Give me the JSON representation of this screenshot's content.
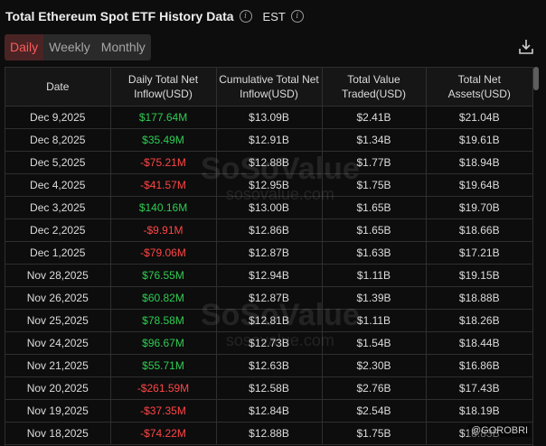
{
  "header": {
    "title": "Total Ethereum Spot ETF History Data",
    "timezone": "EST"
  },
  "tabs": [
    {
      "label": "Daily",
      "active": true
    },
    {
      "label": "Weekly",
      "active": false
    },
    {
      "label": "Monthly",
      "active": false
    }
  ],
  "icons": {
    "info": "info-circle-icon",
    "download": "download-icon"
  },
  "colors": {
    "positive": "#2ecc52",
    "negative": "#ff4545",
    "active_tab": "#ff5a5a"
  },
  "table": {
    "headers": [
      "Date",
      "Daily Total Net Inflow(USD)",
      "Cumulative Total Net Inflow(USD)",
      "Total Value Traded(USD)",
      "Total Net Assets(USD)"
    ],
    "rows": [
      {
        "date": "Dec 9,2025",
        "daily": "$177.64M",
        "sign": "pos",
        "cumulative": "$13.09B",
        "traded": "$2.41B",
        "assets": "$21.04B"
      },
      {
        "date": "Dec 8,2025",
        "daily": "$35.49M",
        "sign": "pos",
        "cumulative": "$12.91B",
        "traded": "$1.34B",
        "assets": "$19.61B"
      },
      {
        "date": "Dec 5,2025",
        "daily": "-$75.21M",
        "sign": "neg",
        "cumulative": "$12.88B",
        "traded": "$1.77B",
        "assets": "$18.94B"
      },
      {
        "date": "Dec 4,2025",
        "daily": "-$41.57M",
        "sign": "neg",
        "cumulative": "$12.95B",
        "traded": "$1.75B",
        "assets": "$19.64B"
      },
      {
        "date": "Dec 3,2025",
        "daily": "$140.16M",
        "sign": "pos",
        "cumulative": "$13.00B",
        "traded": "$1.65B",
        "assets": "$19.70B"
      },
      {
        "date": "Dec 2,2025",
        "daily": "-$9.91M",
        "sign": "neg",
        "cumulative": "$12.86B",
        "traded": "$1.65B",
        "assets": "$18.66B"
      },
      {
        "date": "Dec 1,2025",
        "daily": "-$79.06M",
        "sign": "neg",
        "cumulative": "$12.87B",
        "traded": "$1.63B",
        "assets": "$17.21B"
      },
      {
        "date": "Nov 28,2025",
        "daily": "$76.55M",
        "sign": "pos",
        "cumulative": "$12.94B",
        "traded": "$1.11B",
        "assets": "$19.15B"
      },
      {
        "date": "Nov 26,2025",
        "daily": "$60.82M",
        "sign": "pos",
        "cumulative": "$12.87B",
        "traded": "$1.39B",
        "assets": "$18.88B"
      },
      {
        "date": "Nov 25,2025",
        "daily": "$78.58M",
        "sign": "pos",
        "cumulative": "$12.81B",
        "traded": "$1.11B",
        "assets": "$18.26B"
      },
      {
        "date": "Nov 24,2025",
        "daily": "$96.67M",
        "sign": "pos",
        "cumulative": "$12.73B",
        "traded": "$1.54B",
        "assets": "$18.44B"
      },
      {
        "date": "Nov 21,2025",
        "daily": "$55.71M",
        "sign": "pos",
        "cumulative": "$12.63B",
        "traded": "$2.30B",
        "assets": "$16.86B"
      },
      {
        "date": "Nov 20,2025",
        "daily": "-$261.59M",
        "sign": "neg",
        "cumulative": "$12.58B",
        "traded": "$2.76B",
        "assets": "$17.43B"
      },
      {
        "date": "Nov 19,2025",
        "daily": "-$37.35M",
        "sign": "neg",
        "cumulative": "$12.84B",
        "traded": "$2.54B",
        "assets": "$18.19B"
      },
      {
        "date": "Nov 18,2025",
        "daily": "-$74.22M",
        "sign": "neg",
        "cumulative": "$12.88B",
        "traded": "$1.75B",
        "assets": "$18.83B"
      }
    ]
  },
  "watermark": {
    "brand": "SoSoValue",
    "url": "sosovalue.com"
  },
  "credit": "@GOROBRI"
}
